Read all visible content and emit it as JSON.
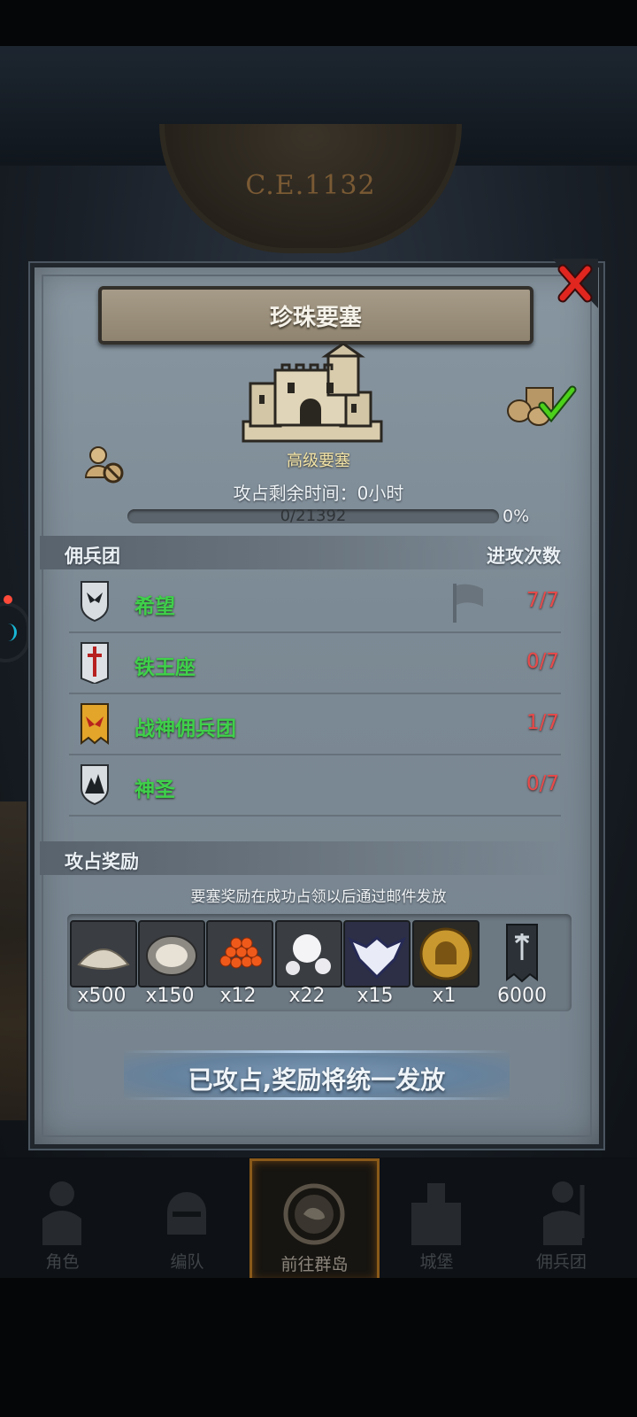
{
  "era": "C.E.1132",
  "panel": {
    "title": "珍珠要塞",
    "fort_type": "高级要塞",
    "remain_time": "攻占剩余时间：0小时",
    "progress_text": "0/21392",
    "progress_percent": "0%",
    "progress_fraction": 0
  },
  "mercenary_section": {
    "header_left": "佣兵团",
    "header_right": "进攻次数",
    "rows": [
      {
        "name": "希望",
        "count": "7/7",
        "icon": "black-bird-shield-icon"
      },
      {
        "name": "铁王座",
        "count": "0/7",
        "icon": "red-sword-shield-icon"
      },
      {
        "name": "战神佣兵团",
        "count": "1/7",
        "icon": "red-bird-banner-icon"
      },
      {
        "name": "神圣",
        "count": "0/7",
        "icon": "mountain-shield-icon"
      }
    ]
  },
  "reward_section": {
    "header": "攻占奖励",
    "note": "要塞奖励在成功占领以后通过邮件发放",
    "items": [
      {
        "icon": "sand-pile-icon",
        "qty": "x500"
      },
      {
        "icon": "oyster-icon",
        "qty": "x150"
      },
      {
        "icon": "red-caviar-icon",
        "qty": "x12"
      },
      {
        "icon": "pearl-icon",
        "qty": "x22"
      },
      {
        "icon": "winged-emblem-icon",
        "qty": "x15"
      },
      {
        "icon": "golden-helmet-coin-icon",
        "qty": "x1"
      },
      {
        "icon": "banner-icon",
        "qty": "6000"
      }
    ]
  },
  "status_button": "已攻占,奖励将统一发放",
  "bottom_nav": [
    {
      "label": "角色",
      "icon": "knight-icon"
    },
    {
      "label": "编队",
      "icon": "helmet-icon"
    },
    {
      "label": "前往群岛",
      "icon": "compass-map-icon"
    },
    {
      "label": "城堡",
      "icon": "castle-icon"
    },
    {
      "label": "佣兵团",
      "icon": "soldier-icon"
    }
  ],
  "colors": {
    "panel_bg": "#8391a0",
    "name_green": "#3fd04a",
    "count_red": "#e84a4a",
    "nav_active_border": "#8a5a1a"
  }
}
